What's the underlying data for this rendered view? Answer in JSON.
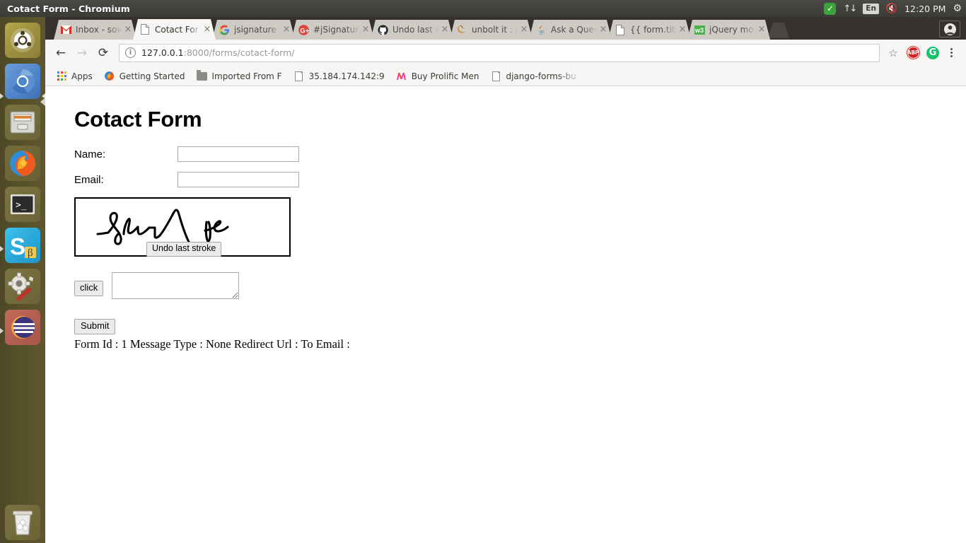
{
  "desktop": {
    "window_title": "Cotact Form - Chromium",
    "tray": {
      "updates_icon": "checkmark-icon",
      "network_icon": "network-updown-icon",
      "keyboard_layout": "En",
      "volume_icon": "volume-muted-icon",
      "clock": "12:20 PM",
      "session_icon": "gear-icon"
    },
    "launcher": [
      {
        "name": "ubuntu-dash",
        "label": "Ubuntu Dash",
        "running": false
      },
      {
        "name": "chromium",
        "label": "Chromium",
        "running": true
      },
      {
        "name": "files",
        "label": "Files",
        "running": false
      },
      {
        "name": "firefox",
        "label": "Firefox",
        "running": false
      },
      {
        "name": "terminal",
        "label": "Terminal",
        "running": false
      },
      {
        "name": "skype",
        "label": "Skype",
        "running": true
      },
      {
        "name": "system-settings",
        "label": "System Settings",
        "running": false
      },
      {
        "name": "eclipse",
        "label": "Eclipse",
        "running": true
      },
      {
        "name": "trash",
        "label": "Trash",
        "running": false
      }
    ]
  },
  "browser": {
    "tabs": [
      {
        "title": "Inbox - sow",
        "favicon": "gmail-icon",
        "active": false
      },
      {
        "title": "Cotact For",
        "favicon": "document-icon",
        "active": true
      },
      {
        "title": "jsignature",
        "favicon": "google-icon",
        "active": false
      },
      {
        "title": "#jSignatur",
        "favicon": "google-plus-icon",
        "active": false
      },
      {
        "title": "Undo last s",
        "favicon": "github-icon",
        "active": false
      },
      {
        "title": "unbolt it : j",
        "favicon": "moon-icon",
        "active": false
      },
      {
        "title": "Ask a Ques",
        "favicon": "java-icon",
        "active": false
      },
      {
        "title": "{{ form.titl",
        "favicon": "document-icon",
        "active": false
      },
      {
        "title": "jQuery mo",
        "favicon": "w3schools-icon",
        "active": false
      }
    ],
    "toolbar": {
      "back_icon": "back-arrow-icon",
      "forward_icon": "forward-arrow-icon",
      "reload_icon": "reload-icon",
      "site_info_icon": "info-circle-icon",
      "url_host": "127.0.0.1",
      "url_path": ":8000/forms/cotact-form/",
      "star_icon": "star-icon",
      "adblock_label": "ABP",
      "grammarly_label": "G",
      "menu_icon": "three-dot-menu-icon",
      "avatar_icon": "person-icon"
    },
    "bookmarks": [
      {
        "label": "Apps",
        "icon": "apps-grid-icon"
      },
      {
        "label": "Getting Started",
        "icon": "firefox-icon"
      },
      {
        "label": "Imported From F",
        "icon": "folder-icon"
      },
      {
        "label": "35.184.174.142:9",
        "icon": "document-icon"
      },
      {
        "label": "Buy Prolific Men",
        "icon": "myntra-icon"
      },
      {
        "label": "django-forms-bu",
        "icon": "document-icon"
      }
    ]
  },
  "page": {
    "title": "Cotact Form",
    "fields": [
      {
        "label": "Name:",
        "value": "",
        "placeholder": ""
      },
      {
        "label": "Email:",
        "value": "",
        "placeholder": ""
      }
    ],
    "signature": {
      "undo_label": "Undo last stroke",
      "has_strokes": true
    },
    "click_label": "click",
    "signature_text_value": "",
    "signature_text_placeholder": "",
    "submit_label": "Submit",
    "status_line": "Form Id : 1 Message Type : None Redirect Url : To Email :"
  }
}
